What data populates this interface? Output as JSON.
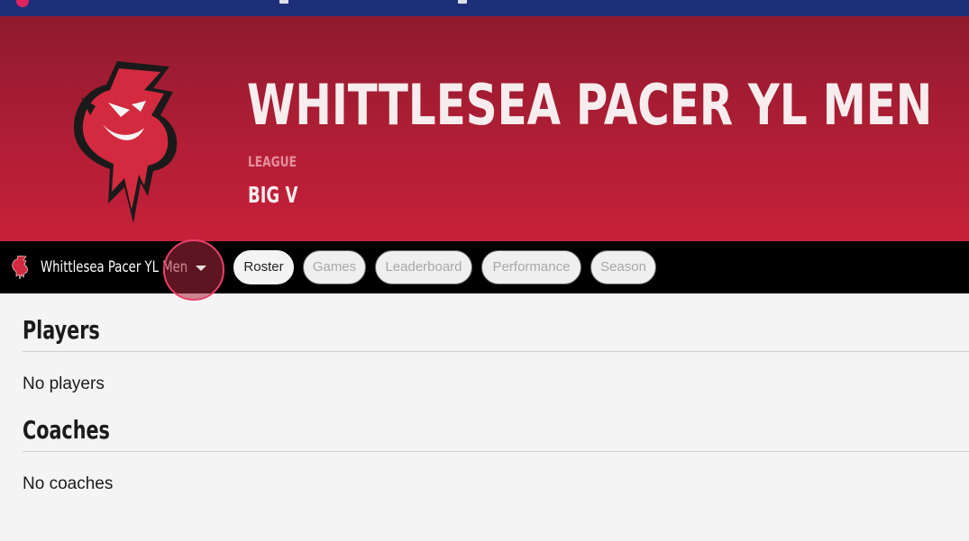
{
  "colors": {
    "hero_top": "#8f1a2e",
    "hero_bottom": "#c7203a",
    "accent_ring": "#e8406a",
    "navbar_bg": "#000000",
    "browser_strip": "#1e2f7a"
  },
  "hero": {
    "title": "WHITTLESEA PACER YL MEN",
    "league_label": "LEAGUE",
    "league_value": "BIG V",
    "logo_icon": "devil-mascot-logo-icon"
  },
  "navbar": {
    "team_name": "Whittlesea Pacer YL Men",
    "team_icon": "devil-mascot-small-icon",
    "dropdown_icon": "caret-down-icon",
    "tabs": [
      {
        "label": "Roster",
        "active": true
      },
      {
        "label": "Games",
        "active": false
      },
      {
        "label": "Leaderboard",
        "active": false
      },
      {
        "label": "Performance",
        "active": false
      },
      {
        "label": "Season",
        "active": false
      }
    ]
  },
  "sections": {
    "players": {
      "heading": "Players",
      "empty_text": "No players"
    },
    "coaches": {
      "heading": "Coaches",
      "empty_text": "No coaches"
    }
  }
}
